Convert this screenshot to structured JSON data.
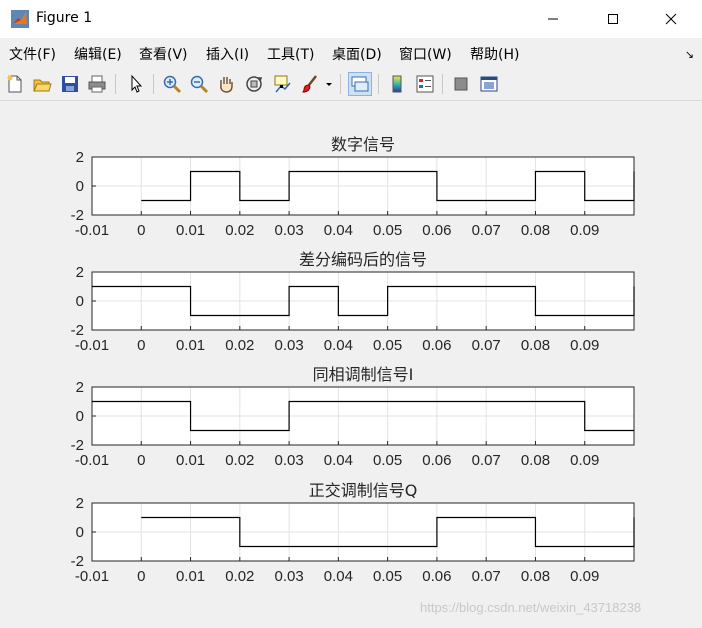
{
  "window": {
    "title": "Figure 1",
    "buttons": [
      "minimize",
      "maximize",
      "close"
    ]
  },
  "menu": {
    "items": [
      "文件(F)",
      "编辑(E)",
      "查看(V)",
      "插入(I)",
      "工具(T)",
      "桌面(D)",
      "窗口(W)",
      "帮助(H)"
    ],
    "dock_arrow": "↘"
  },
  "toolbar": {
    "icons": [
      "new-figure-icon",
      "open-file-icon",
      "save-icon",
      "print-icon",
      "pointer-icon",
      "zoom-in-icon",
      "zoom-out-icon",
      "pan-hand-icon",
      "rotate-3d-icon",
      "data-cursor-icon",
      "brush-icon",
      "link-plot-icon",
      "colorbar-icon",
      "legend-icon",
      "hide-plot-tools-icon",
      "show-plot-tools-icon"
    ]
  },
  "watermark": "https://blog.csdn.net/weixin_43718238",
  "chart_data": [
    {
      "type": "line",
      "title": "数字信号",
      "xlim": [
        -0.01,
        0.1
      ],
      "ylim": [
        -2,
        2
      ],
      "xticks": [
        "-0.01",
        "0",
        "0.01",
        "0.02",
        "0.03",
        "0.04",
        "0.05",
        "0.06",
        "0.07",
        "0.08",
        "0.09"
      ],
      "yticks": [
        "-2",
        "0",
        "2"
      ],
      "grid": true,
      "x": [
        0,
        0.01,
        0.01,
        0.02,
        0.02,
        0.03,
        0.03,
        0.06,
        0.06,
        0.08,
        0.08,
        0.09,
        0.09,
        0.1,
        0.1
      ],
      "y": [
        -1,
        -1,
        1,
        1,
        -1,
        -1,
        1,
        1,
        -1,
        -1,
        1,
        1,
        -1,
        -1,
        1
      ]
    },
    {
      "type": "line",
      "title": "差分编码后的信号",
      "xlim": [
        -0.01,
        0.1
      ],
      "ylim": [
        -2,
        2
      ],
      "xticks": [
        "-0.01",
        "0",
        "0.01",
        "0.02",
        "0.03",
        "0.04",
        "0.05",
        "0.06",
        "0.07",
        "0.08",
        "0.09"
      ],
      "yticks": [
        "-2",
        "0",
        "2"
      ],
      "grid": true,
      "x": [
        -0.01,
        0.01,
        0.01,
        0.03,
        0.03,
        0.04,
        0.04,
        0.05,
        0.05,
        0.08,
        0.08,
        0.1,
        0.1
      ],
      "y": [
        1,
        1,
        -1,
        -1,
        1,
        1,
        -1,
        -1,
        1,
        1,
        -1,
        -1,
        1
      ]
    },
    {
      "type": "line",
      "title": "同相调制信号I",
      "xlim": [
        -0.01,
        0.1
      ],
      "ylim": [
        -2,
        2
      ],
      "xticks": [
        "-0.01",
        "0",
        "0.01",
        "0.02",
        "0.03",
        "0.04",
        "0.05",
        "0.06",
        "0.07",
        "0.08",
        "0.09"
      ],
      "yticks": [
        "-2",
        "0",
        "2"
      ],
      "grid": true,
      "x": [
        -0.01,
        0.01,
        0.01,
        0.03,
        0.03,
        0.09,
        0.09,
        0.1
      ],
      "y": [
        1,
        1,
        -1,
        -1,
        1,
        1,
        -1,
        -1
      ]
    },
    {
      "type": "line",
      "title": "正交调制信号Q",
      "xlim": [
        -0.01,
        0.1
      ],
      "ylim": [
        -2,
        2
      ],
      "xticks": [
        "-0.01",
        "0",
        "0.01",
        "0.02",
        "0.03",
        "0.04",
        "0.05",
        "0.06",
        "0.07",
        "0.08",
        "0.09"
      ],
      "yticks": [
        "-2",
        "0",
        "2"
      ],
      "grid": true,
      "x": [
        0,
        0.02,
        0.02,
        0.06,
        0.06,
        0.08,
        0.08,
        0.1,
        0.1
      ],
      "y": [
        1,
        1,
        -1,
        -1,
        1,
        1,
        -1,
        -1,
        1
      ]
    }
  ]
}
